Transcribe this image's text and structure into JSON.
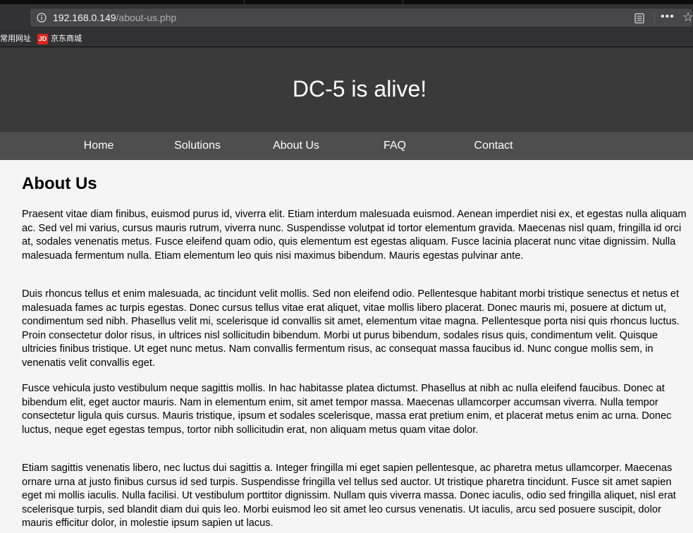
{
  "browser": {
    "url_host": "192.168.0.149",
    "url_path": "/about-us.php",
    "bookmarks": [
      {
        "label": "常用网址"
      },
      {
        "label": "京东商城",
        "icon_text": "JD"
      }
    ]
  },
  "site": {
    "title": "DC-5 is alive!",
    "nav": [
      {
        "label": "Home"
      },
      {
        "label": "Solutions"
      },
      {
        "label": "About Us"
      },
      {
        "label": "FAQ"
      },
      {
        "label": "Contact"
      }
    ]
  },
  "page": {
    "heading": "About Us",
    "paragraphs": [
      "Praesent vitae diam finibus, euismod purus id, viverra elit. Etiam interdum malesuada euismod. Aenean imperdiet nisi ex, et egestas nulla aliquam ac. Sed vel mi varius, cursus mauris rutrum, viverra nunc. Suspendisse volutpat id tortor elementum gravida. Maecenas nisl quam, fringilla id orci at, sodales venenatis metus. Fusce eleifend quam odio, quis elementum est egestas aliquam. Fusce lacinia placerat nunc vitae dignissim. Nulla malesuada fermentum nulla. Etiam elementum leo quis nisi maximus bibendum. Mauris egestas pulvinar ante.",
      "Duis rhoncus tellus et enim malesuada, ac tincidunt velit mollis. Sed non eleifend odio. Pellentesque habitant morbi tristique senectus et netus et malesuada fames ac turpis egestas. Donec cursus tellus vitae erat aliquet, vitae mollis libero placerat. Donec mauris mi, posuere at dictum ut, condimentum sed nibh. Phasellus velit mi, scelerisque id convallis sit amet, elementum vitae magna. Pellentesque porta nisi quis rhoncus luctus. Proin consectetur dolor risus, in ultrices nisl sollicitudin bibendum. Morbi ut purus bibendum, sodales risus quis, condimentum velit. Quisque ultricies finibus tristique. Ut eget nunc metus. Nam convallis fermentum risus, ac consequat massa faucibus id. Nunc congue mollis sem, in venenatis velit convallis eget.",
      "Fusce vehicula justo vestibulum neque sagittis mollis. In hac habitasse platea dictumst. Phasellus at nibh ac nulla eleifend faucibus. Donec at bibendum elit, eget auctor mauris. Nam in elementum enim, sit amet tempor massa. Maecenas ullamcorper accumsan viverra. Nulla tempor consectetur ligula quis cursus. Mauris tristique, ipsum et sodales scelerisque, massa erat pretium enim, et placerat metus enim ac urna. Donec luctus, neque eget egestas tempus, tortor nibh sollicitudin erat, non aliquam metus quam vitae dolor.",
      "Etiam sagittis venenatis libero, nec luctus dui sagittis a. Integer fringilla mi eget sapien pellentesque, ac pharetra metus ullamcorper. Maecenas ornare urna at justo finibus cursus id sed turpis. Suspendisse fringilla vel tellus sed auctor. Ut tristique pharetra tincidunt. Fusce sit amet sapien eget mi mollis iaculis. Nulla facilisi. Ut vestibulum porttitor dignissim. Nullam quis viverra massa. Donec iaculis, odio sed fringilla aliquet, nisl erat scelerisque turpis, sed blandit diam dui quis leo. Morbi euismod leo sit amet leo cursus venenatis. Ut iaculis, arcu sed posuere suscipit, dolor mauris efficitur dolor, in molestie ipsum sapien ut lacus."
    ]
  }
}
